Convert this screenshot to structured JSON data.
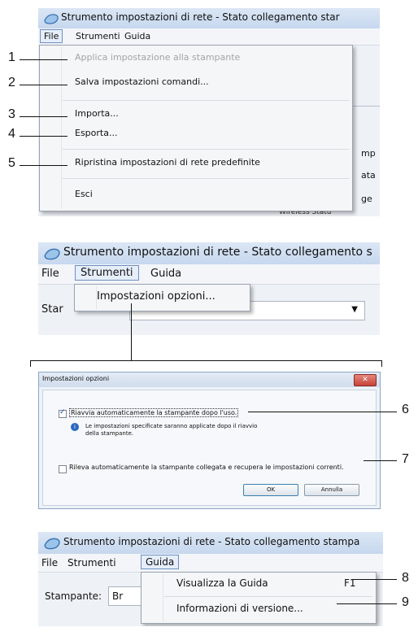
{
  "panel1": {
    "title": "Strumento impostazioni di rete - Stato collegamento star",
    "menubar": [
      "File",
      "Strumenti",
      "Guida"
    ],
    "file_menu": [
      "Applica impostazione alla stampante",
      "Salva impostazioni comandi...",
      "Importa...",
      "Esporta...",
      "Ripristina impostazioni di rete predefinite",
      "Esci"
    ],
    "bg_fragments": [
      "mp",
      "ata",
      "ge",
      "Wireless Statu"
    ]
  },
  "panel2": {
    "title": "Strumento impostazioni di rete - Stato collegamento s",
    "menubar": [
      "File",
      "Strumenti",
      "Guida"
    ],
    "strumenti_menu_item": "Impostazioni opzioni...",
    "bg_label": "Star"
  },
  "dialog": {
    "title": "Impostazioni opzioni",
    "option1": "Riavvia automaticamente la stampante dopo l'uso.",
    "option1_checked": true,
    "info_text": "Le impostazioni specificate saranno applicate dopo il riavvio della stampante.",
    "option2": "Rileva automaticamente la stampante collegata e recupera le impostazioni correnti.",
    "option2_checked": false,
    "ok": "OK",
    "cancel": "Annulla"
  },
  "panel3": {
    "title": "Strumento impostazioni di rete - Stato collegamento stampa",
    "menubar": [
      "File",
      "Strumenti",
      "Guida"
    ],
    "guida_menu": [
      {
        "label": "Visualizza la Guida",
        "shortcut": "F1"
      },
      {
        "label": "Informazioni di versione...",
        "shortcut": ""
      }
    ],
    "bg_label": "Stampante:",
    "bg_field": "Br"
  },
  "callouts": [
    "1",
    "2",
    "3",
    "4",
    "5",
    "6",
    "7",
    "8",
    "9"
  ],
  "colors": {
    "menu_bg": "#f5f6f8",
    "titlebar": "#c6d7ee",
    "selected_menu": "#e6eefb",
    "dialog_close": "#c8433a"
  }
}
